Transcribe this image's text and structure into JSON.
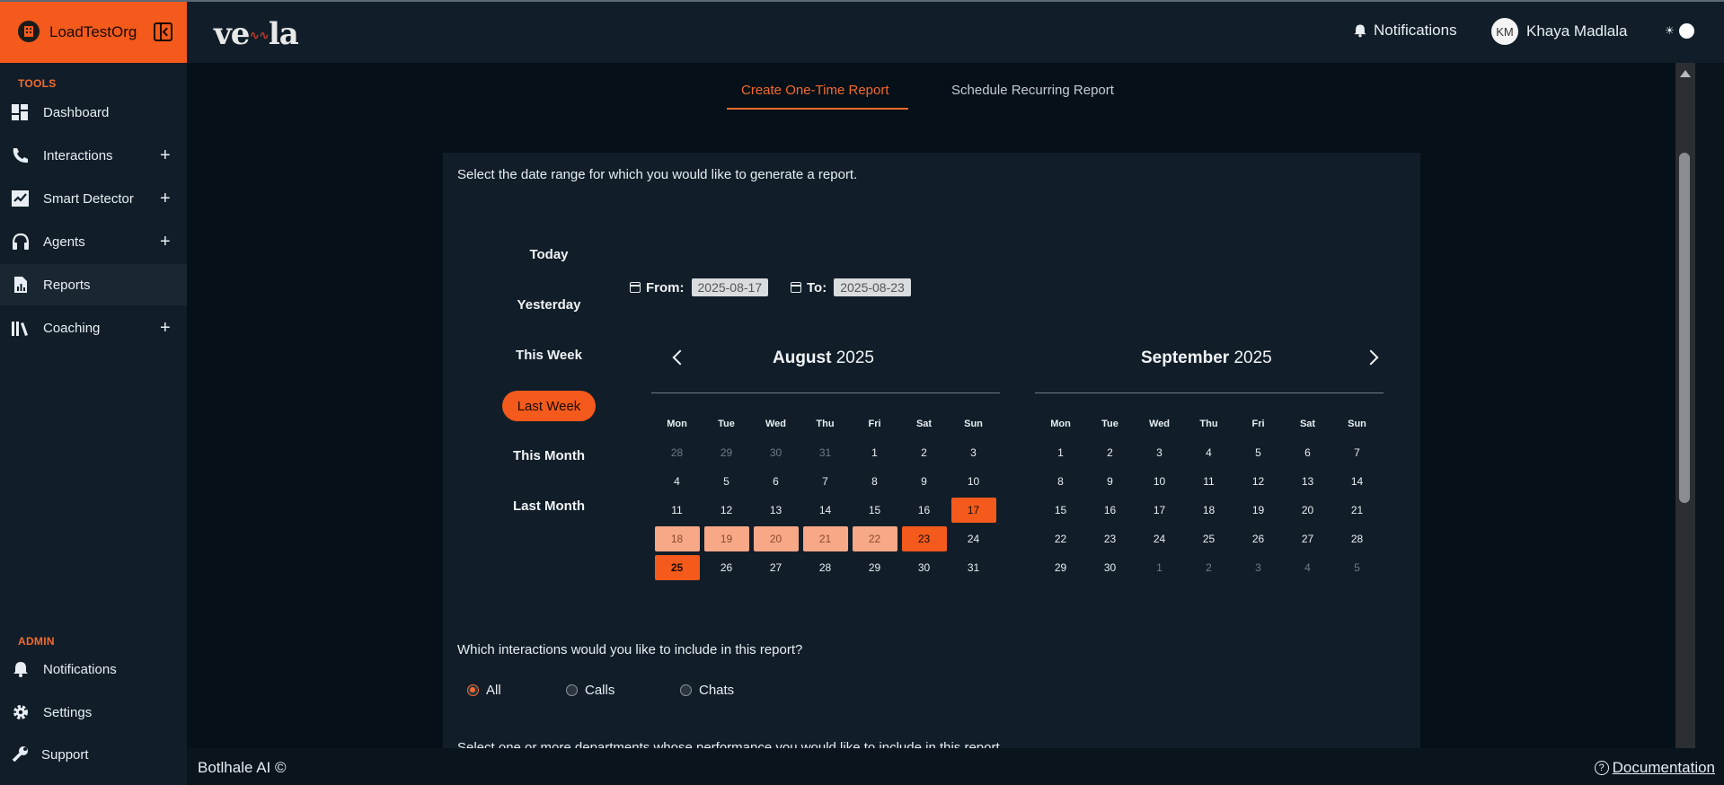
{
  "sidebar": {
    "org_name": "LoadTestOrg",
    "tools_label": "TOOLS",
    "admin_label": "ADMIN",
    "items": [
      {
        "label": "Dashboard",
        "icon": "dashboard-icon"
      },
      {
        "label": "Interactions",
        "icon": "phone-icon",
        "expandable": true
      },
      {
        "label": "Smart Detector",
        "icon": "chart-check-icon",
        "expandable": true
      },
      {
        "label": "Agents",
        "icon": "headset-icon",
        "expandable": true
      },
      {
        "label": "Reports",
        "icon": "report-icon",
        "active": true
      },
      {
        "label": "Coaching",
        "icon": "books-icon",
        "expandable": true
      }
    ],
    "admin_items": [
      {
        "label": "Notifications",
        "icon": "bell-icon"
      },
      {
        "label": "Settings",
        "icon": "gear-icon"
      },
      {
        "label": "Support",
        "icon": "wrench-icon"
      }
    ]
  },
  "header": {
    "brand": "veila",
    "notifications_label": "Notifications",
    "user_initials": "KM",
    "user_name": "Khaya Madlala"
  },
  "tabs": [
    {
      "label": "Create One-Time Report",
      "active": true
    },
    {
      "label": "Schedule Recurring Report",
      "active": false
    }
  ],
  "report": {
    "date_prompt": "Select the date range for which you would like to generate a report.",
    "presets": [
      "Today",
      "Yesterday",
      "This Week",
      "Last Week",
      "This Month",
      "Last Month"
    ],
    "active_preset": "Last Week",
    "from_label": "From:",
    "from_value": "2025-08-17",
    "to_label": "To:",
    "to_value": "2025-08-23",
    "weekdays": [
      "Mon",
      "Tue",
      "Wed",
      "Thu",
      "Fri",
      "Sat",
      "Sun"
    ],
    "calendars": [
      {
        "month": "August",
        "year": "2025",
        "days": [
          {
            "d": "28",
            "s": "muted"
          },
          {
            "d": "29",
            "s": "muted"
          },
          {
            "d": "30",
            "s": "muted"
          },
          {
            "d": "31",
            "s": "muted"
          },
          {
            "d": "1",
            "s": ""
          },
          {
            "d": "2",
            "s": ""
          },
          {
            "d": "3",
            "s": ""
          },
          {
            "d": "4",
            "s": ""
          },
          {
            "d": "5",
            "s": ""
          },
          {
            "d": "6",
            "s": ""
          },
          {
            "d": "7",
            "s": ""
          },
          {
            "d": "8",
            "s": ""
          },
          {
            "d": "9",
            "s": ""
          },
          {
            "d": "10",
            "s": ""
          },
          {
            "d": "11",
            "s": ""
          },
          {
            "d": "12",
            "s": ""
          },
          {
            "d": "13",
            "s": ""
          },
          {
            "d": "14",
            "s": ""
          },
          {
            "d": "15",
            "s": ""
          },
          {
            "d": "16",
            "s": ""
          },
          {
            "d": "17",
            "s": "edge"
          },
          {
            "d": "18",
            "s": "range"
          },
          {
            "d": "19",
            "s": "range"
          },
          {
            "d": "20",
            "s": "range"
          },
          {
            "d": "21",
            "s": "range"
          },
          {
            "d": "22",
            "s": "range"
          },
          {
            "d": "23",
            "s": "edge"
          },
          {
            "d": "24",
            "s": ""
          },
          {
            "d": "25",
            "s": "today"
          },
          {
            "d": "26",
            "s": ""
          },
          {
            "d": "27",
            "s": ""
          },
          {
            "d": "28",
            "s": ""
          },
          {
            "d": "29",
            "s": ""
          },
          {
            "d": "30",
            "s": ""
          },
          {
            "d": "31",
            "s": ""
          }
        ]
      },
      {
        "month": "September",
        "year": "2025",
        "days": [
          {
            "d": "1",
            "s": ""
          },
          {
            "d": "2",
            "s": ""
          },
          {
            "d": "3",
            "s": ""
          },
          {
            "d": "4",
            "s": ""
          },
          {
            "d": "5",
            "s": ""
          },
          {
            "d": "6",
            "s": ""
          },
          {
            "d": "7",
            "s": ""
          },
          {
            "d": "8",
            "s": ""
          },
          {
            "d": "9",
            "s": ""
          },
          {
            "d": "10",
            "s": ""
          },
          {
            "d": "11",
            "s": ""
          },
          {
            "d": "12",
            "s": ""
          },
          {
            "d": "13",
            "s": ""
          },
          {
            "d": "14",
            "s": ""
          },
          {
            "d": "15",
            "s": ""
          },
          {
            "d": "16",
            "s": ""
          },
          {
            "d": "17",
            "s": ""
          },
          {
            "d": "18",
            "s": ""
          },
          {
            "d": "19",
            "s": ""
          },
          {
            "d": "20",
            "s": ""
          },
          {
            "d": "21",
            "s": ""
          },
          {
            "d": "22",
            "s": ""
          },
          {
            "d": "23",
            "s": ""
          },
          {
            "d": "24",
            "s": ""
          },
          {
            "d": "25",
            "s": ""
          },
          {
            "d": "26",
            "s": ""
          },
          {
            "d": "27",
            "s": ""
          },
          {
            "d": "28",
            "s": ""
          },
          {
            "d": "29",
            "s": ""
          },
          {
            "d": "30",
            "s": ""
          },
          {
            "d": "1",
            "s": "muted"
          },
          {
            "d": "2",
            "s": "muted"
          },
          {
            "d": "3",
            "s": "muted"
          },
          {
            "d": "4",
            "s": "muted"
          },
          {
            "d": "5",
            "s": "muted"
          }
        ]
      }
    ],
    "interactions_prompt": "Which interactions would you like to include in this report?",
    "interaction_options": [
      {
        "label": "All",
        "checked": true
      },
      {
        "label": "Calls",
        "checked": false
      },
      {
        "label": "Chats",
        "checked": false
      }
    ],
    "departments_prompt": "Select one or more departments whose performance you would like to include in this report."
  },
  "footer": {
    "left": "Botlhale AI ©",
    "right": "Documentation"
  },
  "colors": {
    "accent": "#f35a1c",
    "range": "#f7a886",
    "sidebar_bg": "#111e29",
    "main_bg": "#061018"
  }
}
